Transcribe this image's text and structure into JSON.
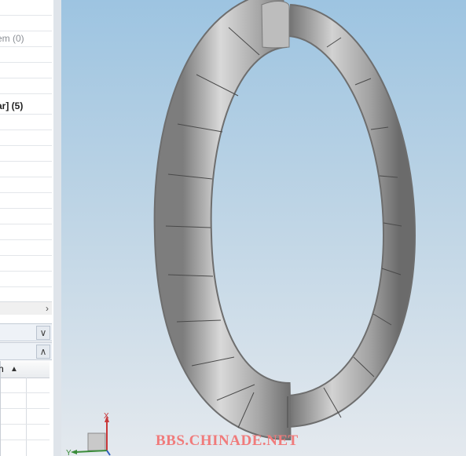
{
  "tree": {
    "rows": [
      {
        "text": "",
        "style": ""
      },
      {
        "text": "",
        "style": ""
      },
      {
        "text": "em (0)",
        "style": "muted"
      },
      {
        "text": "-",
        "style": "muted"
      },
      {
        "text": "-",
        "style": "muted"
      },
      {
        "text": "",
        "style": ""
      },
      {
        "text": "ar] (5)",
        "style": "bold"
      },
      {
        "text": "",
        "style": ""
      },
      {
        "text": "",
        "style": ""
      },
      {
        "text": "",
        "style": ""
      },
      {
        "text": "",
        "style": ""
      },
      {
        "text": "",
        "style": ""
      },
      {
        "text": "",
        "style": ""
      },
      {
        "text": "",
        "style": ""
      },
      {
        "text": "",
        "style": ""
      },
      {
        "text": "",
        "style": ""
      },
      {
        "text": "",
        "style": ""
      },
      {
        "text": "",
        "style": ""
      },
      {
        "text": "",
        "style": ""
      },
      {
        "text": "",
        "style": ""
      }
    ],
    "scroll_right_glyph": "›"
  },
  "panes": {
    "collapse_glyph": "∨",
    "expand_glyph": "∧"
  },
  "grid": {
    "column_header": "n",
    "sort_glyph": "▲"
  },
  "triad": {
    "x_label": "X",
    "y_label": "Y"
  },
  "watermark": "BBS.CHINADE.NET",
  "colors": {
    "viewport_top": "#9dc4e1",
    "viewport_bottom": "#e4e9ee",
    "torus_fill": "#9a9a9a",
    "torus_highlight": "#d6d6d6",
    "watermark": "#f07b7b"
  }
}
